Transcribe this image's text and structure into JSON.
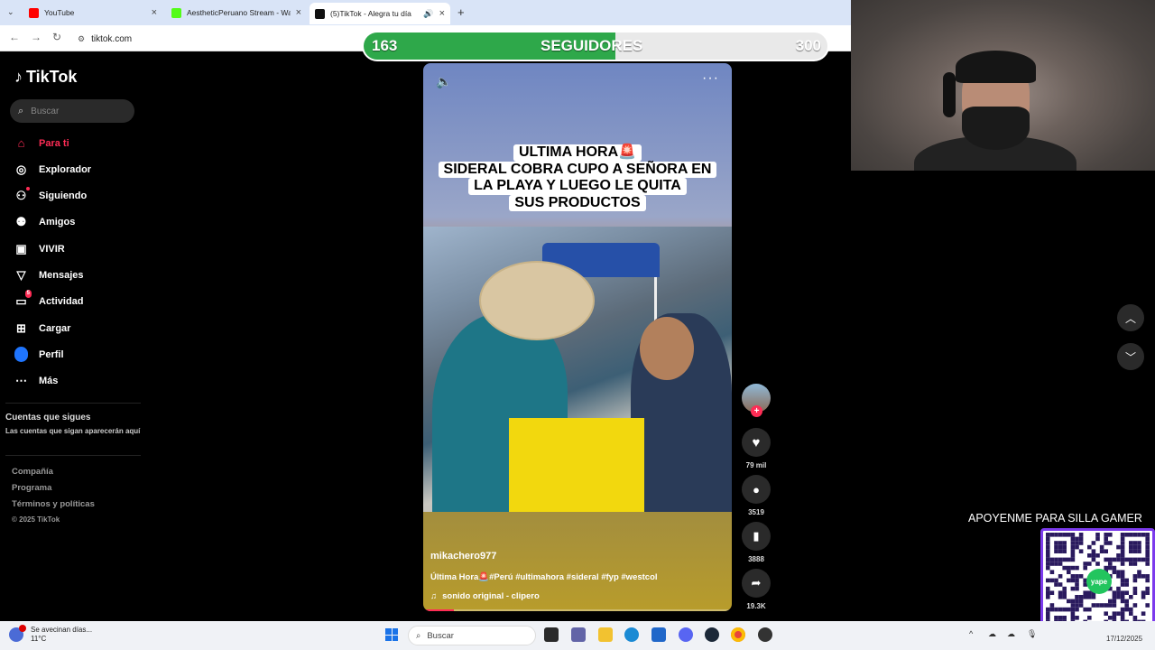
{
  "browser": {
    "tabs": [
      {
        "title": "YouTube",
        "favicon_color": "#ff0000"
      },
      {
        "title": "AestheticPeruano Stream - Wat",
        "favicon_color": "#53fc18"
      },
      {
        "title": "(5)TikTok - Alegra tu día",
        "favicon_color": "#111111"
      }
    ],
    "new_tab": "+",
    "url": "tiktok.com"
  },
  "sidebar": {
    "logo_text": "TikTok",
    "search_placeholder": "Buscar",
    "items": [
      {
        "label": "Para ti",
        "icon": "home-icon",
        "active": true
      },
      {
        "label": "Explorador",
        "icon": "compass-icon"
      },
      {
        "label": "Siguiendo",
        "icon": "following-icon"
      },
      {
        "label": "Amigos",
        "icon": "friends-icon"
      },
      {
        "label": "VIVIR",
        "icon": "live-icon"
      },
      {
        "label": "Mensajes",
        "icon": "send-icon"
      },
      {
        "label": "Actividad",
        "icon": "activity-icon",
        "badge": "5"
      },
      {
        "label": "Cargar",
        "icon": "upload-icon"
      },
      {
        "label": "Perfil",
        "icon": "profile-icon"
      },
      {
        "label": "Más",
        "icon": "more-icon"
      }
    ],
    "following_title": "Cuentas que sigues",
    "following_desc": "Las cuentas que sigan aparecerán aquí",
    "footer": [
      "Compañía",
      "Programa",
      "Términos y políticas",
      "© 2025 TikTok"
    ]
  },
  "follower_goal": {
    "current": "163",
    "label": "SEGUIDORES",
    "target": "300",
    "progress_fraction": 0.543,
    "fill_color": "#2ea84a"
  },
  "video": {
    "caption_lines": [
      "ULTIMA HORA🚨",
      "SIDERAL COBRA CUPO A SEÑORA EN",
      "LA PLAYA Y LUEGO LE QUITA",
      "SUS PRODUCTOS"
    ],
    "author": "mikachero977",
    "description": "Última Hora🚨#Perú #ultimahora #sideral #fyp #westcol",
    "music": "sonido original - clipero",
    "playback_fraction": 0.1
  },
  "actions": {
    "likes": "79 mil",
    "comments": "3519",
    "saves": "3888",
    "shares": "19.3K"
  },
  "overlay": {
    "donate_text": "APOYENME PARA SILLA GAMER",
    "qr_brand": "yape"
  },
  "taskbar": {
    "weather_title": "Se avecinan días...",
    "weather_temp": "11°C",
    "search_placeholder": "Buscar",
    "date": "17/12/2025"
  }
}
